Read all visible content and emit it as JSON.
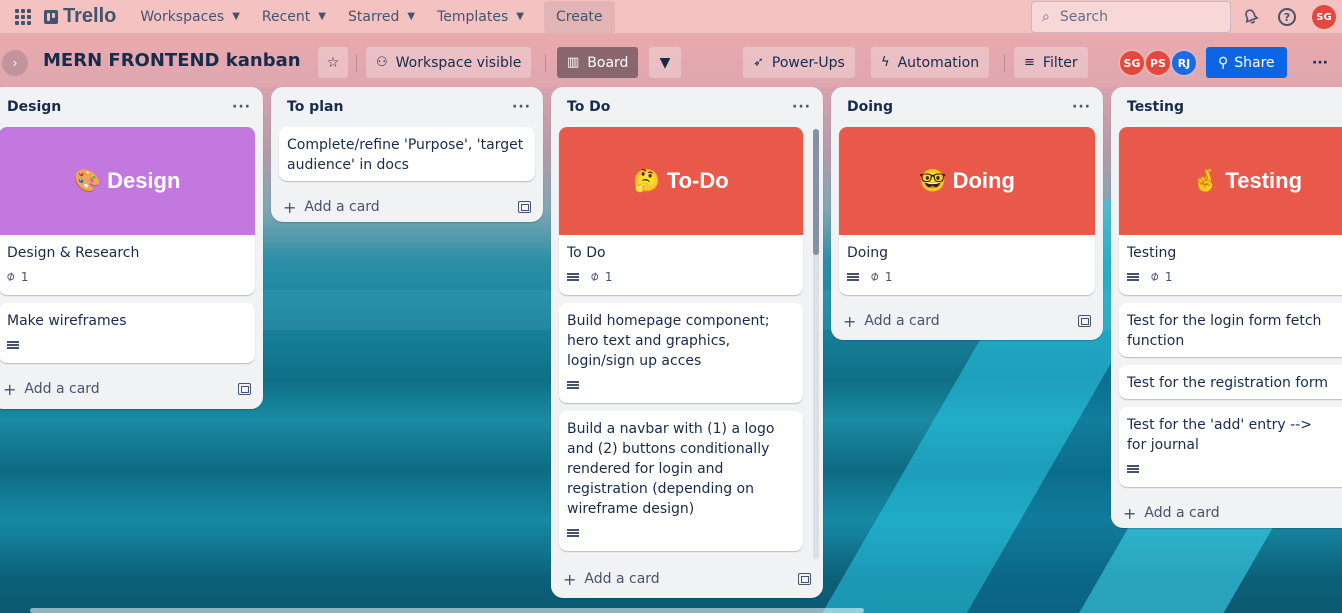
{
  "header": {
    "logo_text": "Trello",
    "nav": [
      {
        "label": "Workspaces"
      },
      {
        "label": "Recent"
      },
      {
        "label": "Starred"
      },
      {
        "label": "Templates"
      }
    ],
    "create_label": "Create",
    "search_placeholder": "Search",
    "user_initials": "SG"
  },
  "board": {
    "title": "MERN FRONTEND kanban",
    "visibility_label": "Workspace visible",
    "view_label": "Board",
    "powerups_label": "Power-Ups",
    "automation_label": "Automation",
    "filter_label": "Filter",
    "members": [
      {
        "initials": "SG",
        "color": "#e2483d"
      },
      {
        "initials": "PS",
        "color": "#e2483d"
      },
      {
        "initials": "RJ",
        "color": "#1d6ae5"
      }
    ],
    "share_label": "Share"
  },
  "lists": [
    {
      "title": "Design",
      "cover": {
        "text": "🎨 Design",
        "color": "#c378e0"
      },
      "cards": [
        {
          "text": "Design & Research",
          "attachments": "1",
          "has_description": false
        },
        {
          "text": "Make wireframes",
          "has_description": true
        }
      ],
      "add_label": "Add a card"
    },
    {
      "title": "To plan",
      "cards": [
        {
          "text": "Complete/refine 'Purpose', 'target audience' in docs"
        }
      ],
      "add_label": "Add a card"
    },
    {
      "title": "To Do",
      "cover": {
        "text": "🤔 To-Do",
        "color": "#e8594a"
      },
      "cards": [
        {
          "text": "To Do",
          "attachments": "1",
          "has_description": true
        },
        {
          "text": "Build homepage component; hero text and graphics, login/sign up acces",
          "has_description": true
        },
        {
          "text": "Build a navbar with (1) a logo and (2) buttons conditionally rendered for login and registration (depending on wireframe design)",
          "has_description": true
        }
      ],
      "add_label": "Add a card"
    },
    {
      "title": "Doing",
      "cover": {
        "text": "🤓 Doing",
        "color": "#e8594a"
      },
      "cards": [
        {
          "text": "Doing",
          "attachments": "1",
          "has_description": true
        }
      ],
      "add_label": "Add a card"
    },
    {
      "title": "Testing",
      "cover": {
        "text": "🤞 Testing",
        "color": "#e8594a"
      },
      "cards": [
        {
          "text": "Testing",
          "attachments": "1",
          "has_description": true
        },
        {
          "text": "Test for the login form fetch function"
        },
        {
          "text": "Test for the registration form"
        },
        {
          "text": "Test for the 'add' entry --> for journal",
          "has_description": true
        }
      ],
      "add_label": "Add a card"
    }
  ],
  "icons": {
    "apps": "apps-grid-icon",
    "search": "search-icon",
    "notifications": "bell-icon",
    "help": "help-icon",
    "star": "star-icon",
    "visibility": "people-icon",
    "board": "board-icon",
    "chevron": "chevron-down-icon",
    "powerups": "rocket-icon",
    "automation": "bolt-icon",
    "filter": "filter-icon",
    "share": "add-person-icon",
    "more": "ellipsis-icon"
  }
}
